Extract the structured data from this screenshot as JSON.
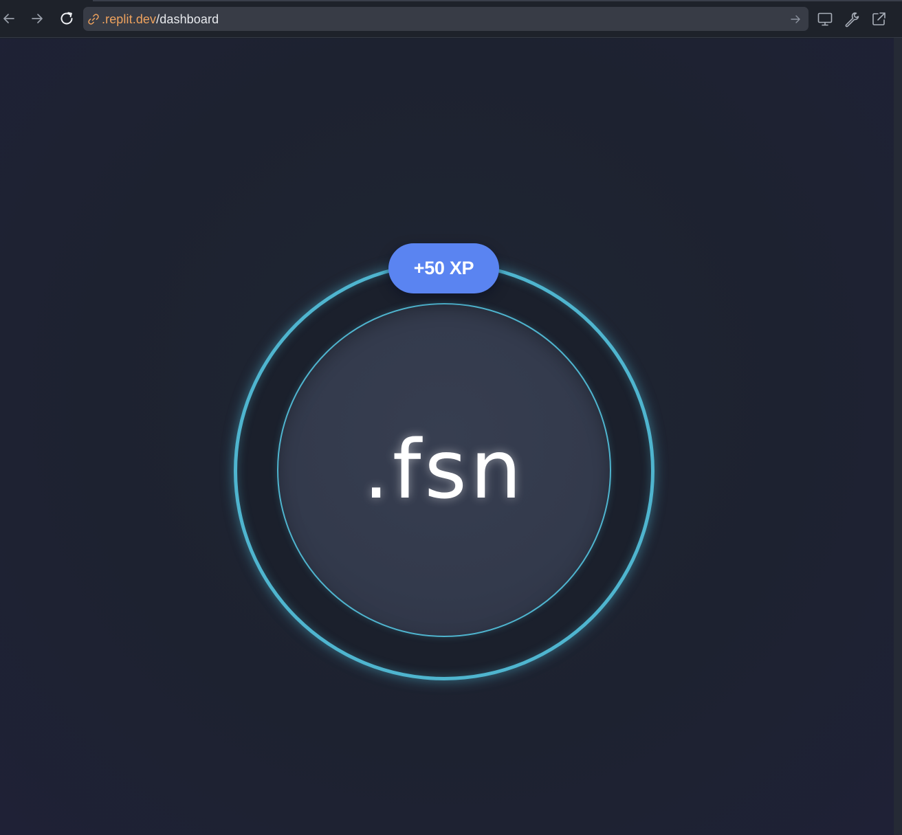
{
  "browser": {
    "url_host": ".replit.dev",
    "url_path": "/dashboard",
    "icons": {
      "back": "arrow-left",
      "forward": "arrow-right",
      "reload": "reload",
      "link": "link",
      "go": "arrow-right",
      "preview": "monitor",
      "devtools": "wrench",
      "open_new_tab": "external-link"
    }
  },
  "main": {
    "logo_text": ".fsn",
    "xp_badge": "+50 XP"
  },
  "colors": {
    "ring_accent": "#4fb5cf",
    "badge": "#5a84f1",
    "url_host": "#f0a35e",
    "background": "#1c212d"
  }
}
